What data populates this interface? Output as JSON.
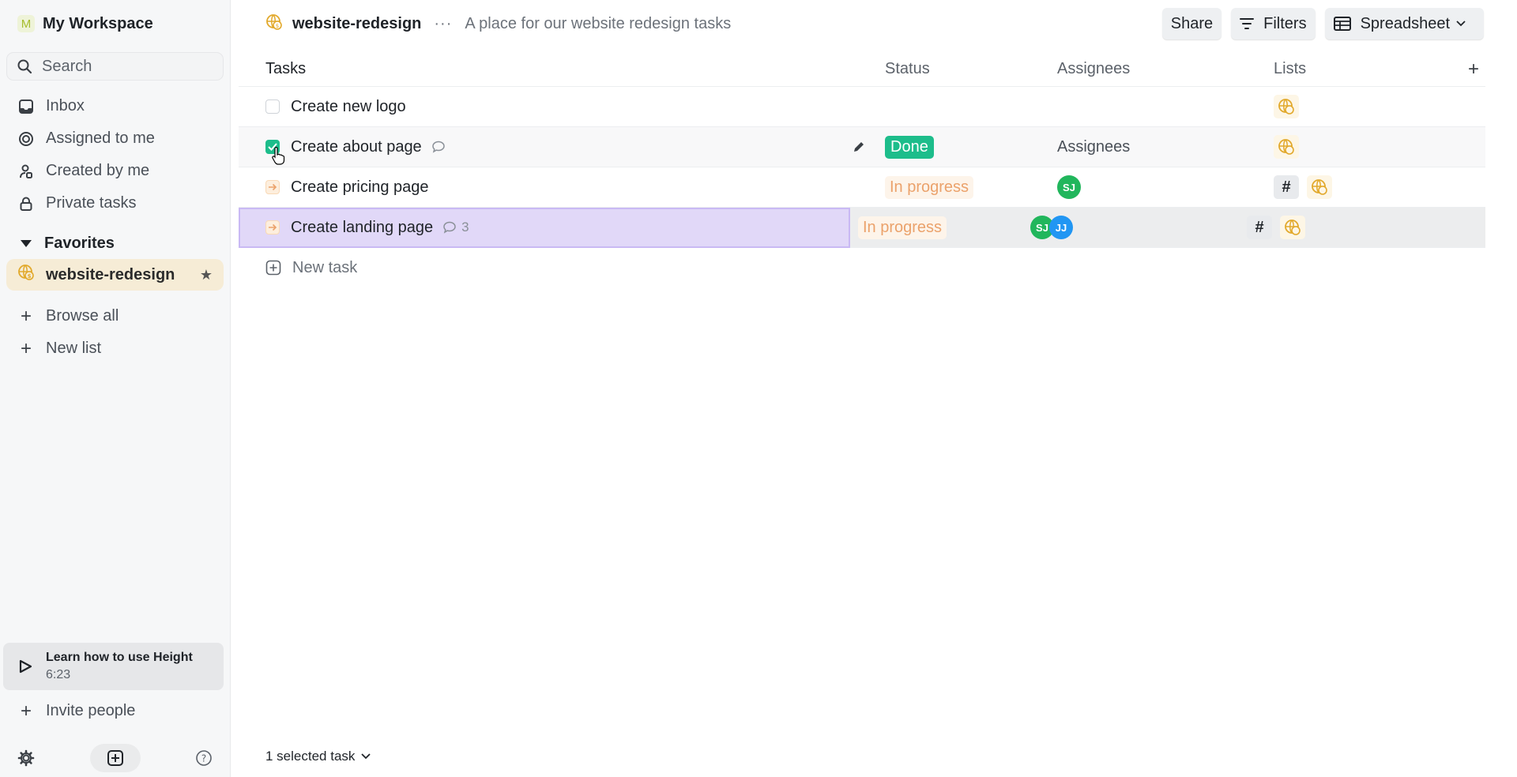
{
  "sidebar": {
    "workspace": {
      "initial": "M",
      "name": "My Workspace"
    },
    "search": {
      "placeholder": "Search"
    },
    "nav": [
      {
        "label": "Inbox",
        "icon": "inbox-icon"
      },
      {
        "label": "Assigned to me",
        "icon": "target-icon"
      },
      {
        "label": "Created by me",
        "icon": "person-icon"
      },
      {
        "label": "Private tasks",
        "icon": "lock-icon"
      }
    ],
    "favorites": {
      "title": "Favorites",
      "items": [
        {
          "label": "website-redesign",
          "icon": "globe-icon",
          "starred": true
        }
      ]
    },
    "actions": [
      {
        "label": "Browse all"
      },
      {
        "label": "New list"
      }
    ],
    "learn": {
      "title": "Learn how to use Height",
      "duration": "6:23"
    },
    "invite": {
      "label": "Invite people"
    }
  },
  "header": {
    "project_name": "website-redesign",
    "more": "···",
    "description": "A place for our website redesign tasks",
    "buttons": {
      "share": "Share",
      "filters": "Filters",
      "view": "Spreadsheet"
    }
  },
  "table": {
    "columns": {
      "tasks": "Tasks",
      "status": "Status",
      "assignees": "Assignees",
      "lists": "Lists",
      "add": "+"
    },
    "rows": [
      {
        "name": "Create new logo",
        "state": "todo",
        "comments": null,
        "status": "",
        "assignees": [],
        "lists": [
          "globe"
        ]
      },
      {
        "name": "Create about page",
        "state": "done",
        "comments": "",
        "status": "Done",
        "assignees_placeholder": "Assignees",
        "assignees": [],
        "lists": [
          "globe"
        ]
      },
      {
        "name": "Create pricing page",
        "state": "in-progress",
        "comments": null,
        "status": "In progress",
        "assignees": [
          "SJ"
        ],
        "lists": [
          "#",
          "globe"
        ]
      },
      {
        "name": "Create landing page",
        "state": "in-progress",
        "comments": "3",
        "status": "In progress",
        "assignees": [
          "SJ",
          "JJ"
        ],
        "lists": [
          "#",
          "globe"
        ]
      }
    ],
    "new_task": "New task"
  },
  "footer": {
    "selection": "1 selected task"
  },
  "colors": {
    "done": "#1dbd8b",
    "in_progress": "#eba26b",
    "selected_row": "#e1d8f8",
    "favorite_bg": "#f6ecd6"
  }
}
